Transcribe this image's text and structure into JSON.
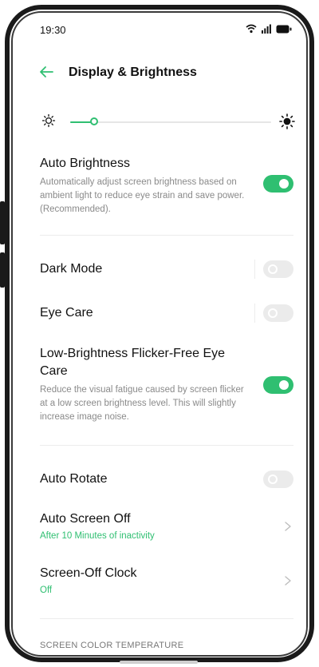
{
  "status_bar": {
    "time": "19:30",
    "icons": [
      "wifi-icon",
      "signal-icon",
      "battery-icon"
    ]
  },
  "header": {
    "back_icon": "arrow-left-icon",
    "title": "Display & Brightness"
  },
  "brightness": {
    "level_percent": 12,
    "min_icon": "sun-small-icon",
    "max_icon": "sun-large-icon"
  },
  "settings": {
    "auto_brightness": {
      "label": "Auto Brightness",
      "description": "Automatically adjust screen brightness based on ambient light to reduce eye strain and save power. (Recommended).",
      "enabled": true
    },
    "dark_mode": {
      "label": "Dark Mode",
      "enabled": false
    },
    "eye_care": {
      "label": "Eye Care",
      "enabled": false
    },
    "flicker_free": {
      "label": "Low-Brightness Flicker-Free Eye Care",
      "description": "Reduce the visual fatigue caused by screen flicker at a low screen brightness level. This will slightly increase image noise.",
      "enabled": true
    },
    "auto_rotate": {
      "label": "Auto Rotate",
      "enabled": false
    },
    "auto_screen_off": {
      "label": "Auto Screen Off",
      "value": "After 10 Minutes of inactivity"
    },
    "screen_off_clock": {
      "label": "Screen-Off Clock",
      "value": "Off"
    }
  },
  "section": {
    "title": "SCREEN COLOR TEMPERATURE"
  },
  "colors": {
    "accent": "#2fbf71",
    "toggle_off": "#ebebeb",
    "secondary_text": "#8a8a8a"
  }
}
